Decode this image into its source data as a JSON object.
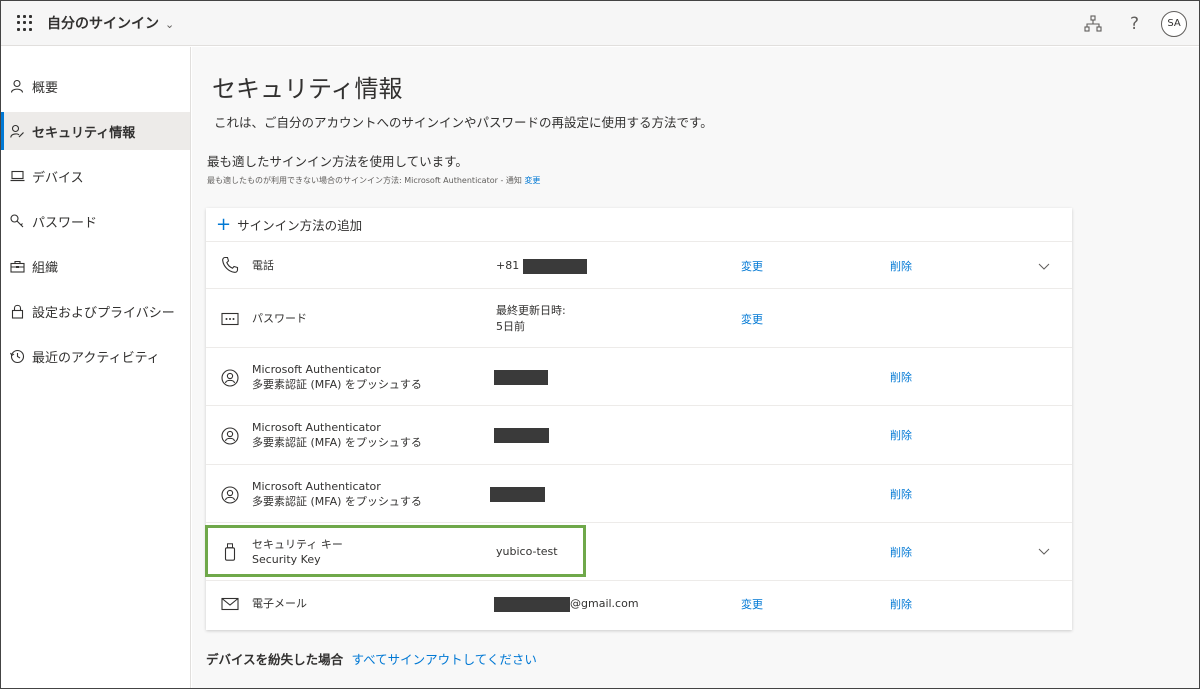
{
  "header": {
    "app_title": "自分のサインイン",
    "avatar_initials": "SA",
    "help_label": "?"
  },
  "sidebar": {
    "items": [
      {
        "label": "概要",
        "icon": "person-icon"
      },
      {
        "label": "セキュリティ情報",
        "icon": "person-key-icon",
        "active": true
      },
      {
        "label": "デバイス",
        "icon": "laptop-icon"
      },
      {
        "label": "パスワード",
        "icon": "key-icon"
      },
      {
        "label": "組織",
        "icon": "briefcase-icon"
      },
      {
        "label": "設定およびプライバシー",
        "icon": "lock-icon"
      },
      {
        "label": "最近のアクティビティ",
        "icon": "history-icon"
      }
    ]
  },
  "main": {
    "title": "セキュリティ情報",
    "description": "これは、ご自分のアカウントへのサインインやパスワードの再設定に使用する方法です。",
    "default_method_line": "最も適したサインイン方法を使用しています。",
    "default_fallback_text": "最も適したものが利用できない場合のサインイン方法: Microsoft Authenticator - 通知",
    "default_change_link": "変更",
    "add_method_label": "サインイン方法の追加",
    "change_label": "変更",
    "delete_label": "削除",
    "methods": [
      {
        "name": "電話",
        "detail": "+81",
        "icon": "phone-icon"
      },
      {
        "name": "パスワード",
        "detail_line1": "最終更新日時:",
        "detail_line2": "5日前",
        "icon": "password-dots-icon"
      },
      {
        "name_line1": "Microsoft Authenticator",
        "name_line2": "多要素認証 (MFA) をプッシュする",
        "icon": "authenticator-icon"
      },
      {
        "name_line1": "Microsoft Authenticator",
        "name_line2": "多要素認証 (MFA) をプッシュする",
        "icon": "authenticator-icon"
      },
      {
        "name_line1": "Microsoft Authenticator",
        "name_line2": "多要素認証 (MFA) をプッシュする",
        "icon": "authenticator-icon"
      },
      {
        "name_line1": "セキュリティ キー",
        "name_line2": "Security Key",
        "detail": "yubico-test",
        "icon": "usb-key-icon"
      },
      {
        "name": "電子メール",
        "detail": "@gmail.com",
        "icon": "mail-icon"
      }
    ],
    "lost_device_text": "デバイスを紛失した場合",
    "lost_device_link": "すべてサインアウトしてください"
  },
  "colors": {
    "accent": "#0078d4",
    "highlight": "#6fa84a",
    "redaction": "#3a3a3a"
  }
}
